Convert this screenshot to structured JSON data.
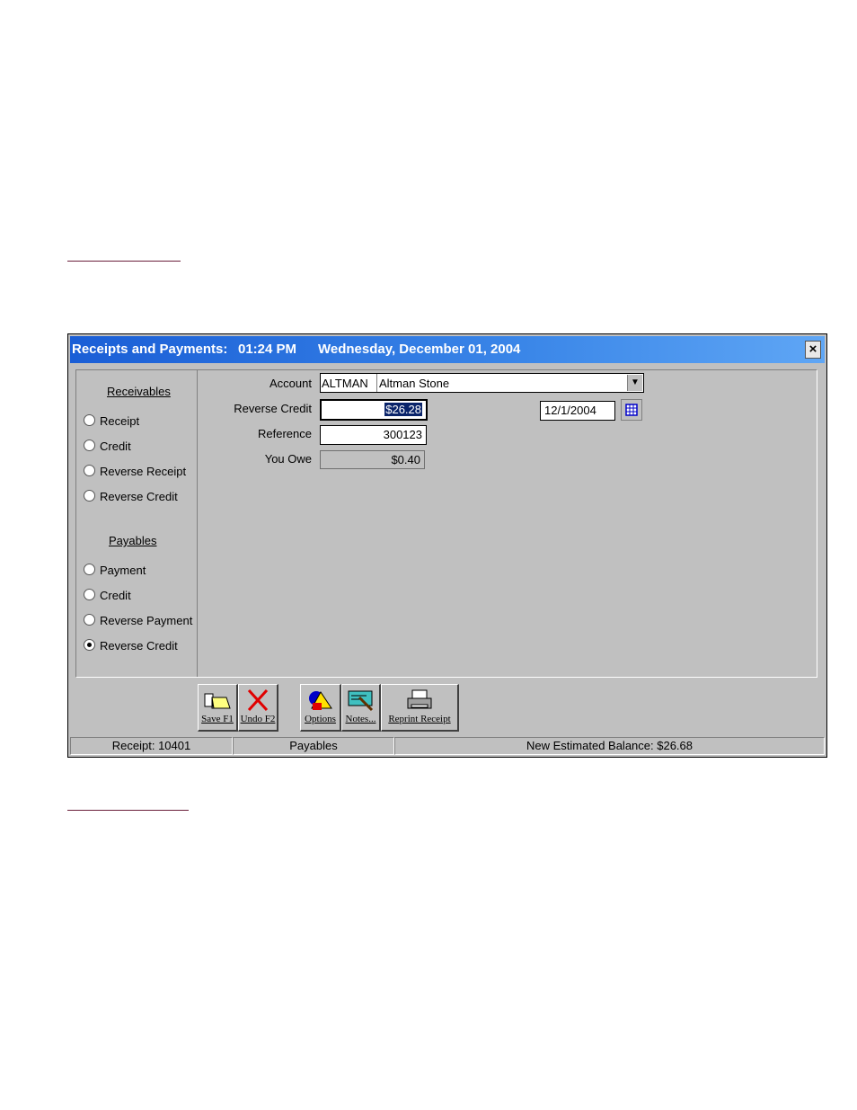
{
  "window": {
    "title": "Receipts and Payments:",
    "time": "01:24 PM",
    "date": "Wednesday, December 01, 2004",
    "close_label": "×"
  },
  "sidebar": {
    "receivables_heading": "Receivables",
    "receivables": [
      {
        "label": "Receipt",
        "selected": false
      },
      {
        "label": "Credit",
        "selected": false
      },
      {
        "label": "Reverse Receipt",
        "selected": false
      },
      {
        "label": "Reverse Credit",
        "selected": false
      }
    ],
    "payables_heading": "Payables",
    "payables": [
      {
        "label": "Payment",
        "selected": false
      },
      {
        "label": "Credit",
        "selected": false
      },
      {
        "label": "Reverse Payment",
        "selected": false
      },
      {
        "label": "Reverse Credit",
        "selected": true
      }
    ]
  },
  "form": {
    "account_label": "Account",
    "account_code": "ALTMAN",
    "account_name": "Altman Stone",
    "amount_label": "Reverse Credit",
    "amount_value": "$26.28",
    "date_value": "12/1/2004",
    "reference_label": "Reference",
    "reference_value": "300123",
    "you_owe_label": "You Owe",
    "you_owe_value": "$0.40"
  },
  "toolbar": {
    "save_label": "Save F1",
    "undo_label": "Undo F2",
    "options_label": "Options",
    "notes_label": "Notes...",
    "reprint_label": "Reprint Receipt"
  },
  "status": {
    "receipt": "Receipt:  10401",
    "mode": "Payables",
    "balance": "New Estimated Balance:  $26.68"
  },
  "colors": {
    "titlebar": "#1a5ed6",
    "window_bg": "#c0c0c0",
    "selection": "#0a246a"
  }
}
